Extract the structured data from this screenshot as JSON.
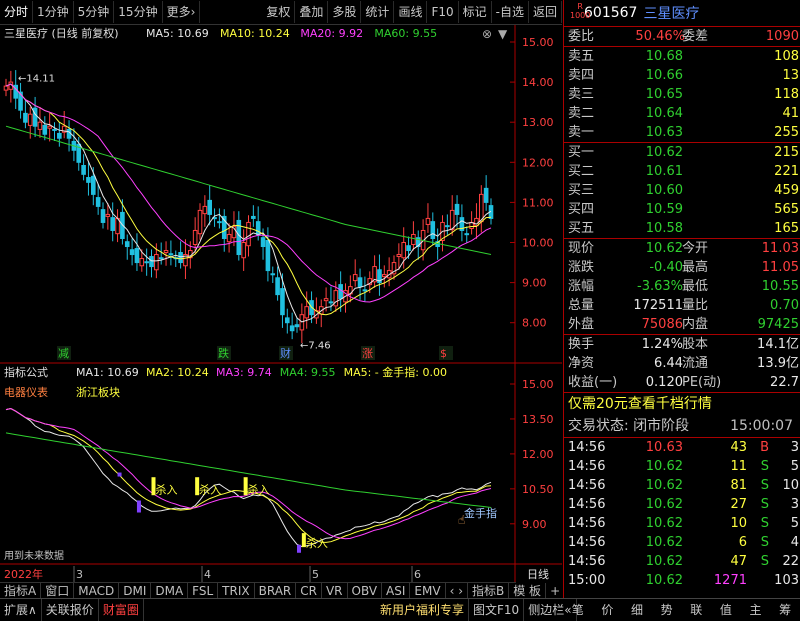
{
  "toolbar": {
    "left": [
      "分时",
      "1分钟",
      "5分钟",
      "15分钟",
      "更多›"
    ],
    "right": [
      "复权",
      "叠加",
      "多股",
      "统计",
      "画线",
      "F10",
      "标记",
      "-自选",
      "返回"
    ]
  },
  "main_chart": {
    "title": "三星医疗 (日线 前复权)",
    "ma_labels": [
      {
        "text": "MA5: 10.69",
        "color": "#e8e8e8"
      },
      {
        "text": "MA10: 10.24",
        "color": "#ffff40"
      },
      {
        "text": "MA20: 9.92",
        "color": "#ff40ff"
      },
      {
        "text": "MA60: 9.55",
        "color": "#30d030"
      }
    ],
    "y_ticks": [
      "15.00",
      "14.00",
      "13.00",
      "12.00",
      "11.00",
      "10.00",
      "9.00",
      "8.00"
    ],
    "high_mark": "14.11",
    "low_mark": "7.46",
    "signals": [
      {
        "text": "减",
        "color": "#30d030"
      },
      {
        "text": "跌",
        "color": "#30d030"
      },
      {
        "text": "财",
        "color": "#5f8fff"
      },
      {
        "text": "涨",
        "color": "#ff4040"
      },
      {
        "text": "$",
        "color": "#ff4040"
      }
    ]
  },
  "indicator": {
    "title": "指标公式",
    "ma_labels": [
      {
        "text": "MA1: 10.69",
        "color": "#e8e8e8"
      },
      {
        "text": "MA2: 10.24",
        "color": "#ffff40"
      },
      {
        "text": "MA3: 9.74",
        "color": "#ff40ff"
      },
      {
        "text": "MA4: 9.55",
        "color": "#30d030"
      },
      {
        "text": "MA5: - 金手指: 0.00",
        "color": "#ffff40"
      }
    ],
    "tag1": "电器仪表",
    "tag2": "浙江板块",
    "y_ticks": [
      "15.00",
      "13.50",
      "12.00",
      "10.50",
      "9.00"
    ],
    "buy_label": "杀入",
    "jin_label": "金手指",
    "future_note": "用到未来数据"
  },
  "x_axis": {
    "year": "2022年",
    "months": [
      "3",
      "4",
      "5",
      "6"
    ],
    "period": "日线"
  },
  "indicator_tabs": [
    "指标A",
    "窗口",
    "MACD",
    "DMI",
    "DMA",
    "FSL",
    "TRIX",
    "BRAR",
    "CR",
    "VR",
    "OBV",
    "ASI",
    "EMV",
    "‹ ›",
    "指标B",
    "模 板",
    "+",
    "-"
  ],
  "bottom_tabs": [
    "扩展∧",
    "关联报价",
    "财富圈"
  ],
  "bottom_right": [
    "新用户福利专享",
    "图文F10",
    "侧边栏«"
  ],
  "bottom_icons": [
    "笔",
    "价",
    "细",
    "势",
    "联",
    "值",
    "主",
    "筹"
  ],
  "stock": {
    "badge": "R\n1000",
    "code": "601567",
    "name": "三星医疗"
  },
  "weibi": {
    "label": "委比",
    "value": "50.46%",
    "label2": "委差",
    "value2": "1090"
  },
  "asks": [
    {
      "label": "卖五",
      "price": "10.68",
      "vol": "108"
    },
    {
      "label": "卖四",
      "price": "10.66",
      "vol": "13"
    },
    {
      "label": "卖三",
      "price": "10.65",
      "vol": "118"
    },
    {
      "label": "卖二",
      "price": "10.64",
      "vol": "41"
    },
    {
      "label": "卖一",
      "price": "10.63",
      "vol": "255"
    }
  ],
  "bids": [
    {
      "label": "买一",
      "price": "10.62",
      "vol": "215"
    },
    {
      "label": "买二",
      "price": "10.61",
      "vol": "221"
    },
    {
      "label": "买三",
      "price": "10.60",
      "vol": "459"
    },
    {
      "label": "买四",
      "price": "10.59",
      "vol": "565"
    },
    {
      "label": "买五",
      "price": "10.58",
      "vol": "165"
    }
  ],
  "quote": [
    {
      "l1": "现价",
      "v1": "10.62",
      "c1": "green",
      "l2": "今开",
      "v2": "11.03",
      "c2": "red"
    },
    {
      "l1": "涨跌",
      "v1": "-0.40",
      "c1": "green",
      "l2": "最高",
      "v2": "11.05",
      "c2": "red"
    },
    {
      "l1": "涨幅",
      "v1": "-3.63%",
      "c1": "green",
      "l2": "最低",
      "v2": "10.55",
      "c2": "green"
    },
    {
      "l1": "总量",
      "v1": "172511",
      "c1": "white",
      "l2": "量比",
      "v2": "0.70",
      "c2": "green"
    },
    {
      "l1": "外盘",
      "v1": "75086",
      "c1": "red",
      "l2": "内盘",
      "v2": "97425",
      "c2": "green"
    }
  ],
  "finance": [
    {
      "l1": "换手",
      "v1": "1.24%",
      "l2": "股本",
      "v2": "14.1亿"
    },
    {
      "l1": "净资",
      "v1": "6.44",
      "l2": "流通",
      "v2": "13.9亿"
    },
    {
      "l1": "收益(一)",
      "v1": "0.120",
      "l2": "PE(动)",
      "v2": "22.7"
    }
  ],
  "promo": "仅需20元查看千档行情",
  "status": {
    "label": "交易状态: 闭市阶段",
    "time": "15:00:07"
  },
  "ticks": [
    {
      "t": "14:56",
      "p": "10.63",
      "pc": "red",
      "v": "43",
      "bs": "B",
      "n": "3"
    },
    {
      "t": "14:56",
      "p": "10.62",
      "pc": "green",
      "v": "11",
      "bs": "S",
      "n": "5"
    },
    {
      "t": "14:56",
      "p": "10.62",
      "pc": "green",
      "v": "81",
      "bs": "S",
      "n": "10"
    },
    {
      "t": "14:56",
      "p": "10.62",
      "pc": "green",
      "v": "27",
      "bs": "S",
      "n": "3"
    },
    {
      "t": "14:56",
      "p": "10.62",
      "pc": "green",
      "v": "10",
      "bs": "S",
      "n": "5"
    },
    {
      "t": "14:56",
      "p": "10.62",
      "pc": "green",
      "v": "6",
      "bs": "S",
      "n": "4"
    },
    {
      "t": "14:56",
      "p": "10.62",
      "pc": "green",
      "v": "47",
      "bs": "S",
      "n": "22"
    },
    {
      "t": "15:00",
      "p": "10.62",
      "pc": "green",
      "v": "1271",
      "bs": "",
      "n": "103"
    }
  ],
  "colors": {
    "up": "#ff4040",
    "down": "#30d030",
    "ma5": "#e8e8e8",
    "ma10": "#ffff40",
    "ma20": "#ff40ff",
    "ma60": "#30d030",
    "candle_down": "#20c0e0",
    "border": "#aa0000"
  }
}
